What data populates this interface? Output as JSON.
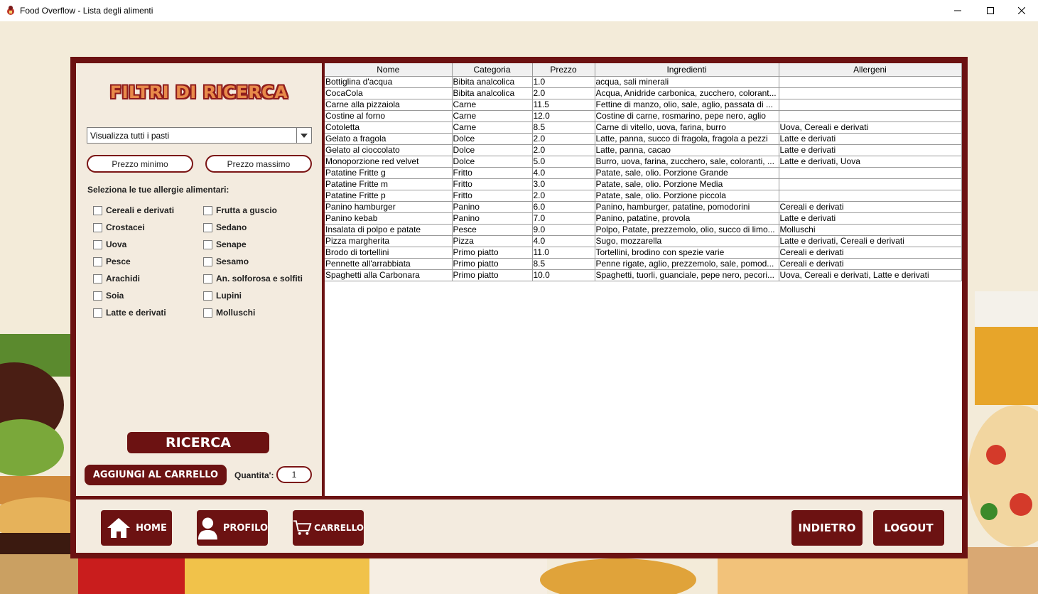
{
  "window": {
    "title": "Food Overflow - Lista degli alimenti"
  },
  "filters": {
    "title": "FILTRI DI RICERCA",
    "meal_select": "Visualizza tutti i pasti",
    "min_price_placeholder": "Prezzo minimo",
    "max_price_placeholder": "Prezzo massimo",
    "allergy_label": "Seleziona le tue allergie alimentari:",
    "allergies_left": [
      "Cereali e derivati",
      "Crostacei",
      "Uova",
      "Pesce",
      "Arachidi",
      "Soia",
      "Latte e derivati"
    ],
    "allergies_right": [
      "Frutta a guscio",
      "Sedano",
      "Senape",
      "Sesamo",
      "An. solforosa e solfiti",
      "Lupini",
      "Molluschi"
    ],
    "search_button": "RICERCA",
    "add_to_cart_button": "AGGIUNGI AL CARRELLO",
    "quantity_label": "Quantita':",
    "quantity_value": "1"
  },
  "table": {
    "columns": [
      "Nome",
      "Categoria",
      "Prezzo",
      "Ingredienti",
      "Allergeni"
    ],
    "rows": [
      [
        "Bottiglina d'acqua",
        "Bibita analcolica",
        "1.0",
        "acqua, sali minerali",
        ""
      ],
      [
        "CocaCola",
        "Bibita analcolica",
        "2.0",
        "Acqua, Anidride carbonica, zucchero, colorant...",
        ""
      ],
      [
        "Carne alla pizzaiola",
        "Carne",
        "11.5",
        "Fettine di manzo, olio, sale, aglio, passata di ...",
        ""
      ],
      [
        "Costine al forno",
        "Carne",
        "12.0",
        "Costine di carne, rosmarino, pepe nero, aglio",
        ""
      ],
      [
        "Cotoletta",
        "Carne",
        "8.5",
        "Carne di vitello, uova, farina, burro",
        "Uova, Cereali e derivati"
      ],
      [
        "Gelato a fragola",
        "Dolce",
        "2.0",
        "Latte, panna, succo di fragola, fragola a pezzi",
        "Latte e derivati"
      ],
      [
        "Gelato al cioccolato",
        "Dolce",
        "2.0",
        "Latte, panna, cacao",
        "Latte e derivati"
      ],
      [
        "Monoporzione red velvet",
        "Dolce",
        "5.0",
        "Burro, uova, farina, zucchero, sale, coloranti, ...",
        "Latte e derivati, Uova"
      ],
      [
        "Patatine Fritte g",
        "Fritto",
        "4.0",
        "Patate, sale, olio. Porzione Grande",
        ""
      ],
      [
        "Patatine Fritte m",
        "Fritto",
        "3.0",
        "Patate, sale, olio. Porzione Media",
        ""
      ],
      [
        "Patatine Fritte p",
        "Fritto",
        "2.0",
        "Patate, sale, olio. Porzione piccola",
        ""
      ],
      [
        "Panino hamburger",
        "Panino",
        "6.0",
        "Panino, hamburger, patatine, pomodorini",
        "Cereali e derivati"
      ],
      [
        "Panino kebab",
        "Panino",
        "7.0",
        "Panino, patatine, provola",
        "Latte e derivati"
      ],
      [
        "Insalata di polpo e patate",
        "Pesce",
        "9.0",
        "Polpo, Patate, prezzemolo, olio, succo di limo...",
        "Molluschi"
      ],
      [
        "Pizza margherita",
        "Pizza",
        "4.0",
        "Sugo, mozzarella",
        "Latte e derivati, Cereali e derivati"
      ],
      [
        "Brodo di tortellini",
        "Primo piatto",
        "11.0",
        "Tortellini, brodino con spezie varie",
        "Cereali e derivati"
      ],
      [
        "Pennette all'arrabbiata",
        "Primo piatto",
        "8.5",
        "Penne rigate, aglio, prezzemolo, sale, pomod...",
        "Cereali e derivati"
      ],
      [
        "Spaghetti alla Carbonara",
        "Primo piatto",
        "10.0",
        "Spaghetti, tuorli, guanciale, pepe nero, pecori...",
        "Uova, Cereali e derivati, Latte e derivati"
      ]
    ]
  },
  "nav": {
    "home": "HOME",
    "profile": "PROFILO",
    "cart": "CARRELLO",
    "back": "INDIETRO",
    "logout": "LOGOUT"
  },
  "colors": {
    "frame": "#6c1212",
    "panel": "#f3ebdf",
    "background": "#f3ebd9",
    "title_fill": "#e88a4a"
  }
}
